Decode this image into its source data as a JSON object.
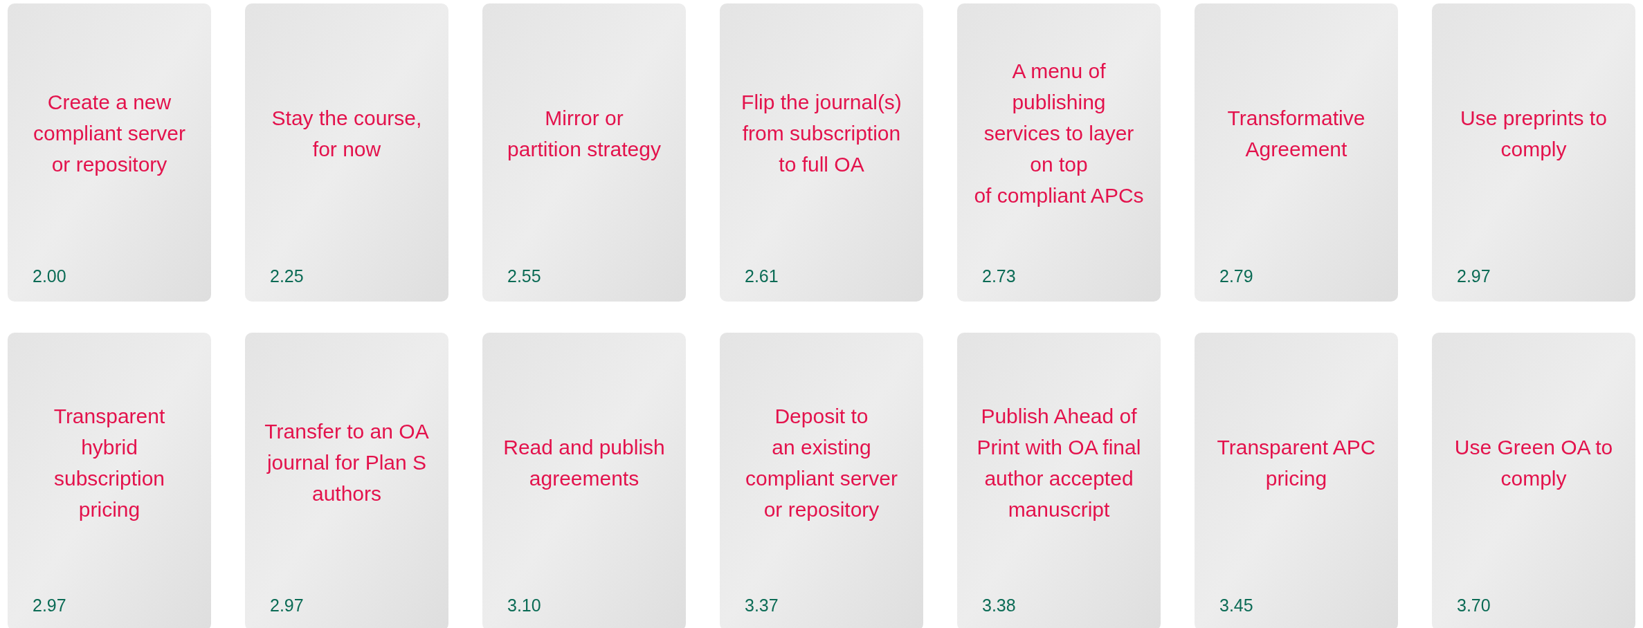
{
  "cards": [
    {
      "title": "Create a new\ncompliant server\nor repository",
      "score": "2.00"
    },
    {
      "title": "Stay the course,\nfor now",
      "score": "2.25"
    },
    {
      "title": "Mirror or\npartition strategy",
      "score": "2.55"
    },
    {
      "title": "Flip the journal(s)\nfrom subscription\nto full OA",
      "score": "2.61"
    },
    {
      "title": "A menu of\npublishing\nservices to layer\non top\nof compliant APCs",
      "score": "2.73"
    },
    {
      "title": "Transformative\nAgreement",
      "score": "2.79"
    },
    {
      "title": "Use preprints to\ncomply",
      "score": "2.97"
    },
    {
      "title": "Transparent\nhybrid\nsubscription\npricing",
      "score": "2.97"
    },
    {
      "title": "Transfer to an OA\njournal for Plan S\nauthors",
      "score": "2.97"
    },
    {
      "title": "Read and publish\nagreements",
      "score": "3.10"
    },
    {
      "title": "Deposit to\nan existing\ncompliant server\nor repository",
      "score": "3.37"
    },
    {
      "title": "Publish Ahead of\nPrint with OA final\nauthor accepted\nmanuscript",
      "score": "3.38"
    },
    {
      "title": "Transparent APC\npricing",
      "score": "3.45"
    },
    {
      "title": "Use Green OA to\ncomply",
      "score": "3.70"
    }
  ]
}
